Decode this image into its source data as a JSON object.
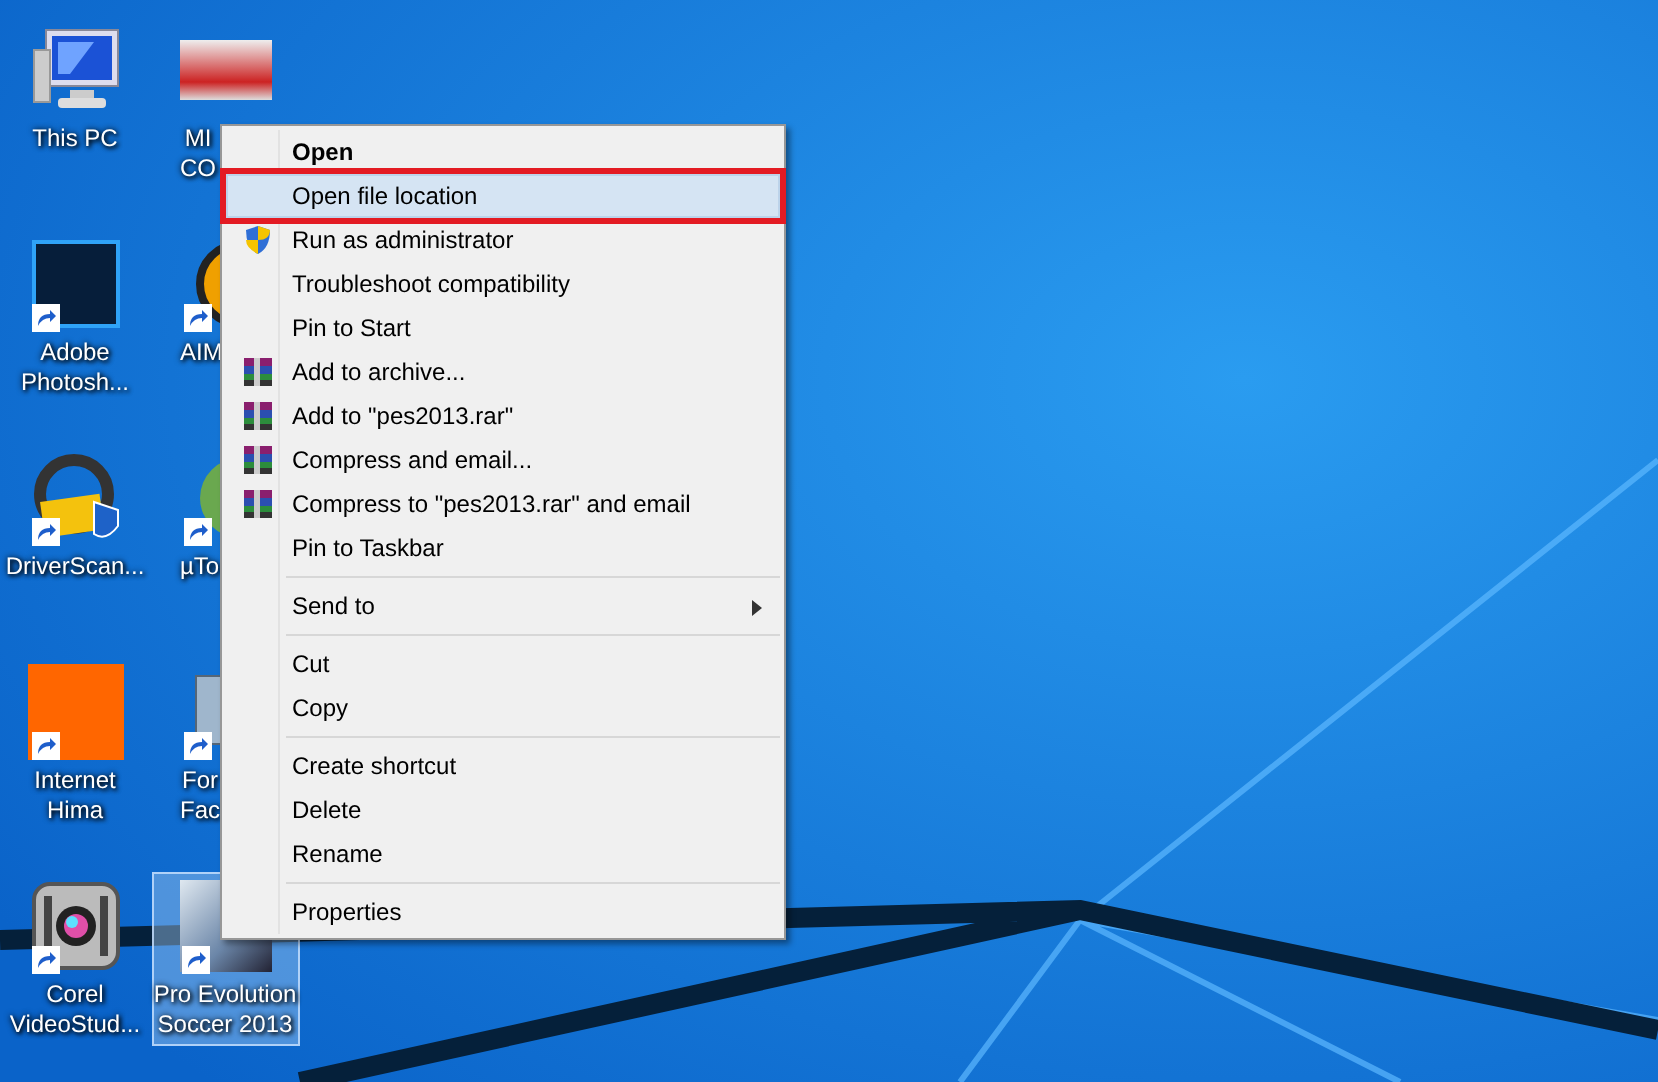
{
  "desktop_icons": [
    {
      "kind": "computer",
      "label": [
        "This PC"
      ],
      "shortcut": false,
      "selected": false,
      "partly_hidden": false
    },
    {
      "kind": "photoshop",
      "label": [
        "Adobe",
        "Photosh..."
      ],
      "shortcut": true,
      "selected": false,
      "partly_hidden": false
    },
    {
      "kind": "driver",
      "label": [
        "DriverScan..."
      ],
      "shortcut": true,
      "selected": false,
      "partly_hidden": false
    },
    {
      "kind": "orange",
      "label": [
        "Internet",
        "Hima"
      ],
      "shortcut": true,
      "selected": false,
      "partly_hidden": false
    },
    {
      "kind": "video",
      "label": [
        "Corel",
        "VideoStud..."
      ],
      "shortcut": true,
      "selected": false,
      "partly_hidden": false
    },
    {
      "kind": "banner",
      "label": [
        "MI",
        "CO"
      ],
      "shortcut": false,
      "selected": false,
      "partly_hidden": true
    },
    {
      "kind": "round",
      "label": [
        "AIM"
      ],
      "shortcut": true,
      "selected": false,
      "partly_hidden": true
    },
    {
      "kind": "green",
      "label": [
        "µTo"
      ],
      "shortcut": true,
      "selected": false,
      "partly_hidden": true
    },
    {
      "kind": "film",
      "label": [
        "For",
        "Fac"
      ],
      "shortcut": true,
      "selected": false,
      "partly_hidden": true
    },
    {
      "kind": "game",
      "label": [
        "Pro Evolution",
        "Soccer 2013"
      ],
      "shortcut": true,
      "selected": true,
      "partly_hidden": false
    }
  ],
  "context_menu": {
    "items": [
      {
        "kind": "item",
        "label": "Open",
        "bold": true,
        "selected": false
      },
      {
        "kind": "item",
        "label": "Open file location",
        "bold": false,
        "selected": true
      },
      {
        "kind": "shield",
        "label": "Run as administrator",
        "bold": false,
        "selected": false
      },
      {
        "kind": "item",
        "label": "Troubleshoot compatibility",
        "bold": false,
        "selected": false
      },
      {
        "kind": "item",
        "label": "Pin to Start",
        "bold": false,
        "selected": false
      },
      {
        "kind": "archive",
        "label": "Add to archive...",
        "bold": false,
        "selected": false
      },
      {
        "kind": "archive",
        "label": "Add to \"pes2013.rar\"",
        "bold": false,
        "selected": false
      },
      {
        "kind": "archive",
        "label": "Compress and email...",
        "bold": false,
        "selected": false
      },
      {
        "kind": "archive",
        "label": "Compress to \"pes2013.rar\" and email",
        "bold": false,
        "selected": false
      },
      {
        "kind": "item",
        "label": "Pin to Taskbar",
        "bold": false,
        "selected": false
      },
      {
        "kind": "separator"
      },
      {
        "kind": "submenu",
        "label": "Send to",
        "bold": false,
        "selected": false
      },
      {
        "kind": "separator"
      },
      {
        "kind": "item",
        "label": "Cut",
        "bold": false,
        "selected": false
      },
      {
        "kind": "item",
        "label": "Copy",
        "bold": false,
        "selected": false
      },
      {
        "kind": "separator"
      },
      {
        "kind": "item",
        "label": "Create shortcut",
        "bold": false,
        "selected": false
      },
      {
        "kind": "item",
        "label": "Delete",
        "bold": false,
        "selected": false
      },
      {
        "kind": "item",
        "label": "Rename",
        "bold": false,
        "selected": false
      },
      {
        "kind": "separator"
      },
      {
        "kind": "item",
        "label": "Properties",
        "bold": false,
        "selected": false
      }
    ]
  }
}
